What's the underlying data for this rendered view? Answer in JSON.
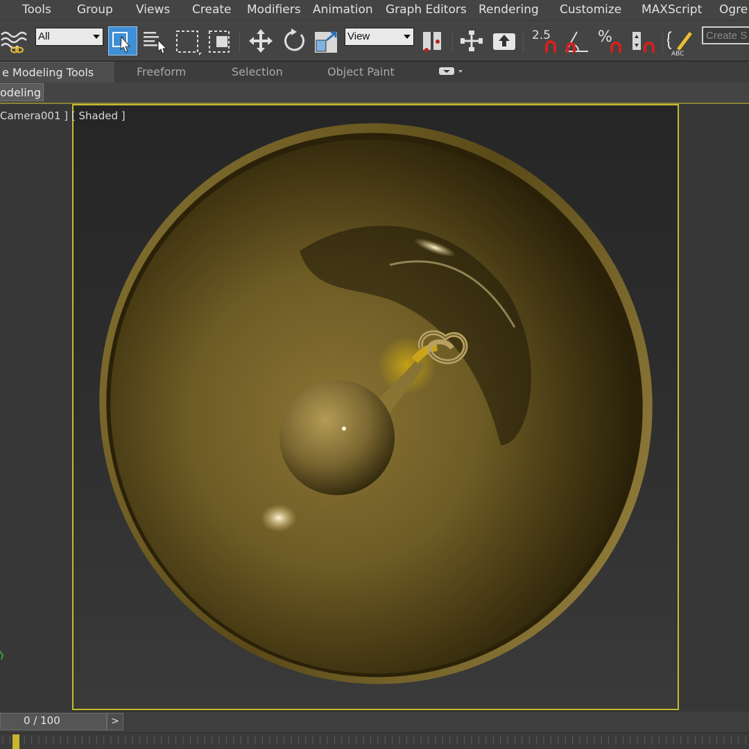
{
  "menu": [
    "Tools",
    "Group",
    "Views",
    "Create",
    "Modifiers",
    "Animation",
    "Graph Editors",
    "Rendering",
    "Customize",
    "MAXScript",
    "Ogre"
  ],
  "toolbar": {
    "selection_filter": "All",
    "coord_system": "View",
    "snap_label": "2.5",
    "percent_label": "%",
    "abc_label": "ABC",
    "named_selection_placeholder": "Create S",
    "icons": [
      "bind-spacewarp-icon",
      "select-object-icon",
      "select-by-name-icon",
      "rect-region-icon",
      "window-crossing-icon",
      "move-icon",
      "rotate-icon",
      "scale-icon",
      "pivot-icon",
      "manipulate-icon",
      "keyboard-shortcut-icon",
      "snap-toggle-icon",
      "angle-snap-icon",
      "percent-snap-icon",
      "spinner-snap-icon",
      "edit-named-selection-icon"
    ],
    "accent": "#3d8fd6"
  },
  "ribbon": {
    "tabs": [
      "e Modeling Tools",
      "Freeform",
      "Selection",
      "Object Paint"
    ],
    "active_tab": "e Modeling Tools",
    "panel_label": "odeling"
  },
  "viewport": {
    "label": "Camera001 ] [ Shaded ]",
    "border_color": "#c8bc2a",
    "axis_label": "y"
  },
  "timeline": {
    "frame_text": "0 / 100",
    "next_label": ">"
  }
}
